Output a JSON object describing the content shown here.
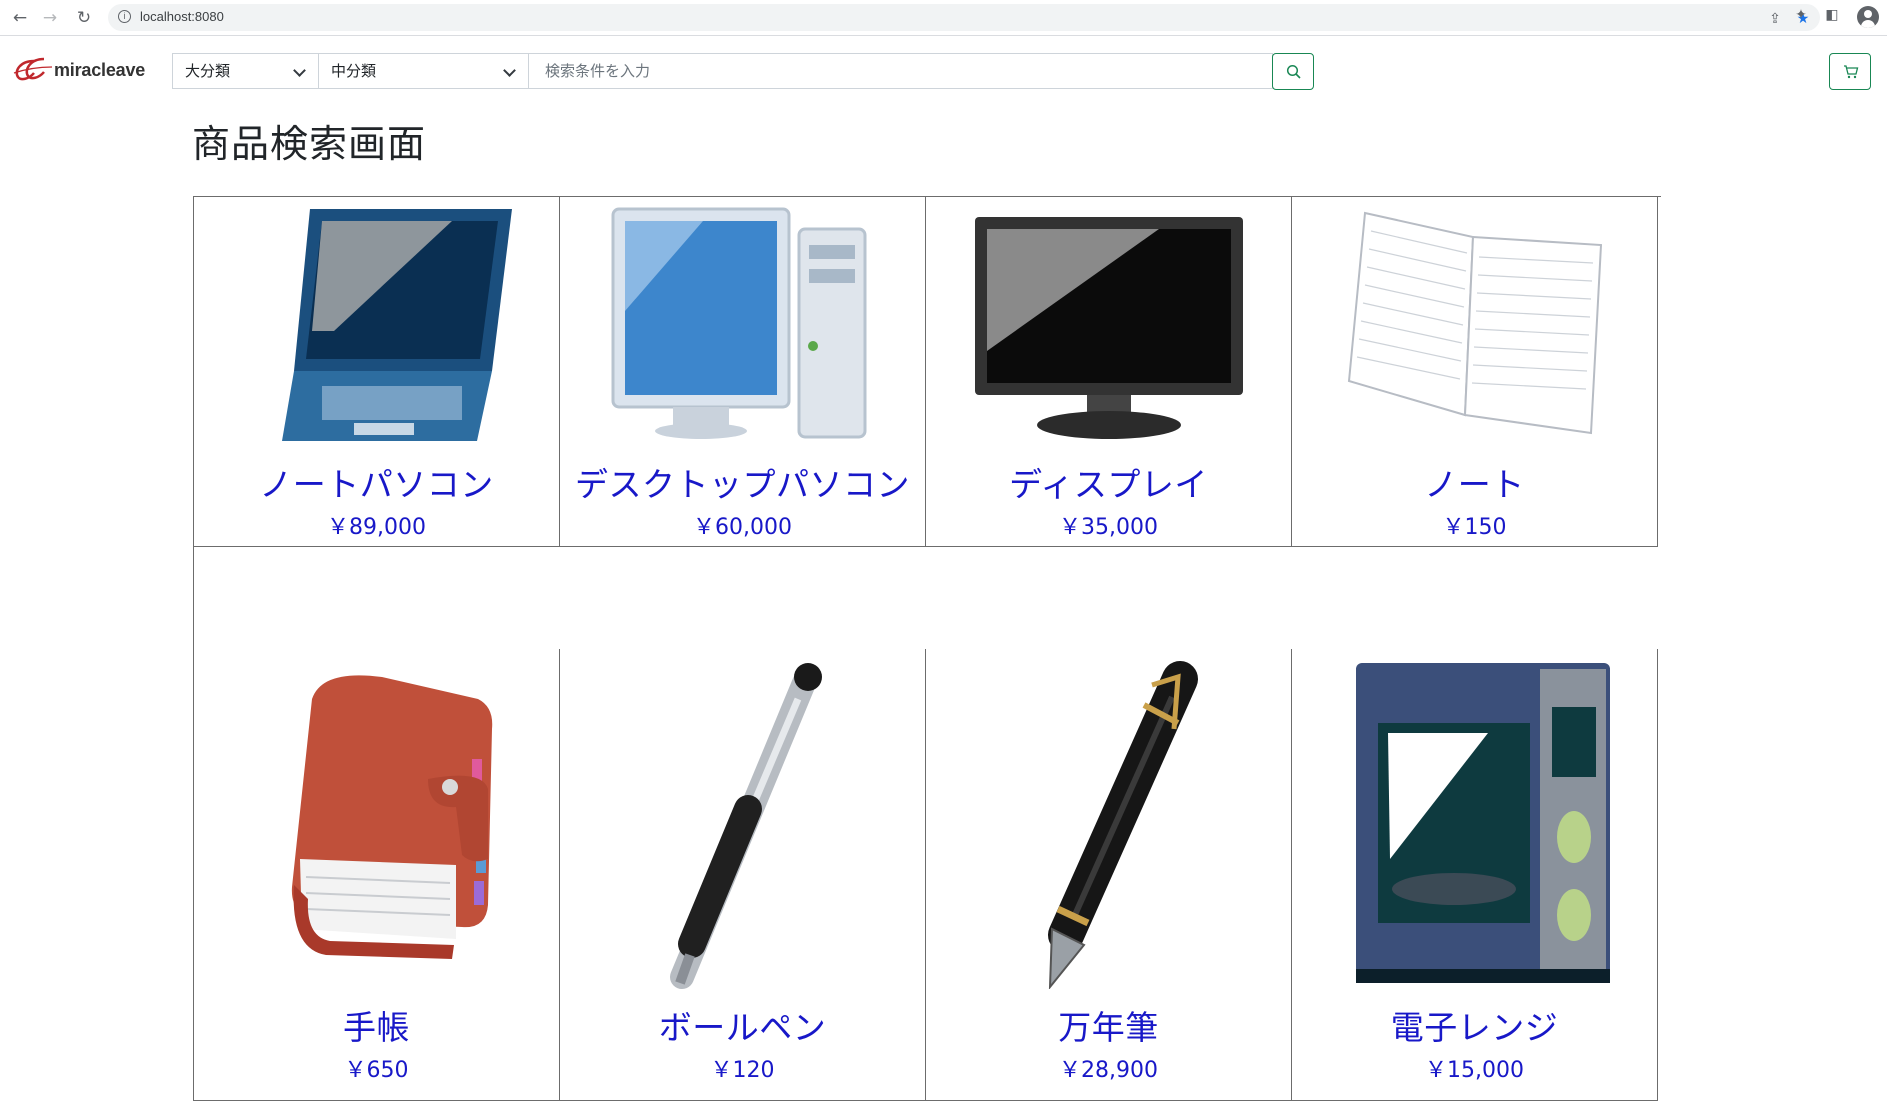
{
  "browser": {
    "url": "localhost:8080"
  },
  "header": {
    "logo_text": "miracleave",
    "category_major": "大分類",
    "category_middle": "中分類",
    "search_placeholder": "検索条件を入力"
  },
  "page": {
    "title": "商品検索画面"
  },
  "products": [
    {
      "name": "ノートパソコン",
      "price": "￥89,000",
      "icon": "laptop-icon"
    },
    {
      "name": "デスクトップパソコン",
      "price": "￥60,000",
      "icon": "desktop-pc-icon"
    },
    {
      "name": "ディスプレイ",
      "price": "￥35,000",
      "icon": "monitor-icon"
    },
    {
      "name": "ノート",
      "price": "￥150",
      "icon": "notebook-icon"
    },
    {
      "name": "手帳",
      "price": "￥650",
      "icon": "planner-icon"
    },
    {
      "name": "ボールペン",
      "price": "￥120",
      "icon": "ballpoint-pen-icon"
    },
    {
      "name": "万年筆",
      "price": "￥28,900",
      "icon": "fountain-pen-icon"
    },
    {
      "name": "電子レンジ",
      "price": "￥15,000",
      "icon": "microwave-icon"
    }
  ],
  "colors": {
    "accent_green": "#198754",
    "link_blue": "#1818c8"
  }
}
